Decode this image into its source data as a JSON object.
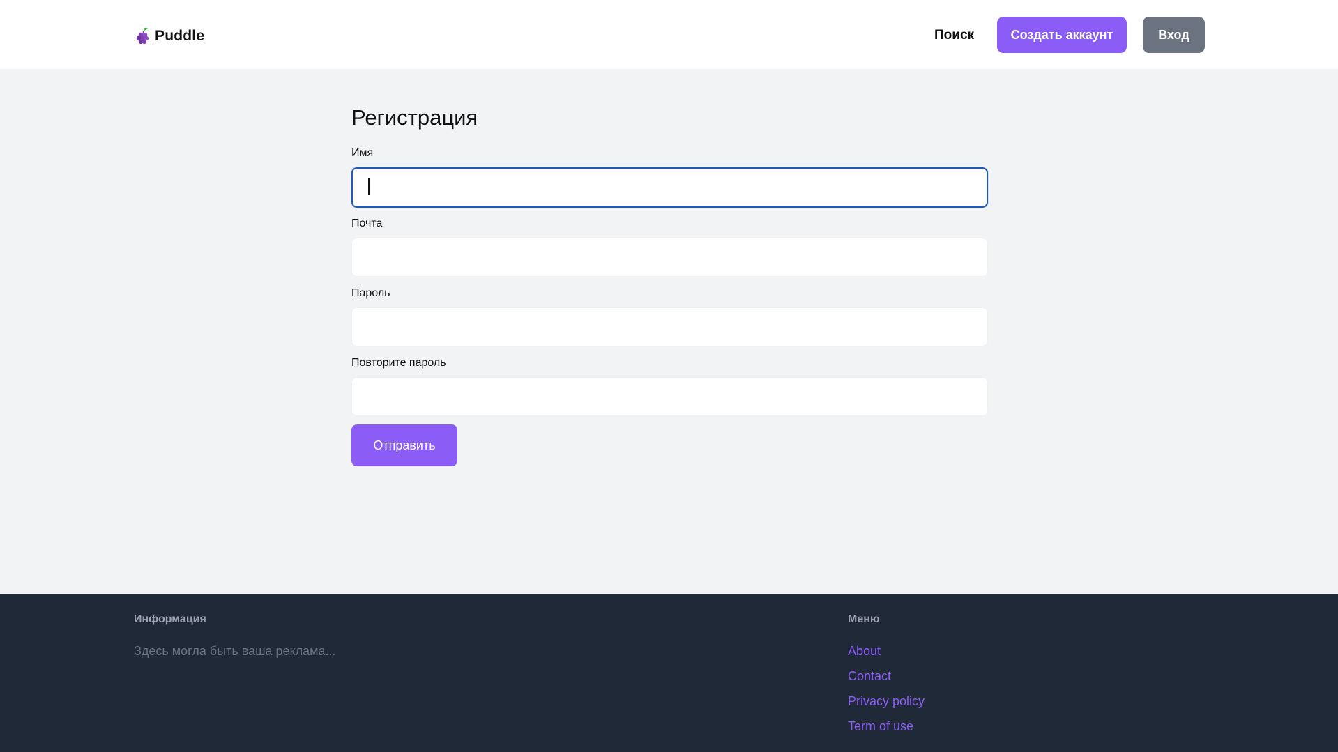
{
  "header": {
    "brand": "Puddle",
    "logo_icon": "grapes-icon",
    "nav_search": "Поиск",
    "create_account": "Создать аккаунт",
    "login": "Вход"
  },
  "form": {
    "title": "Регистрация",
    "fields": [
      {
        "label": "Имя",
        "value": "",
        "focused": true
      },
      {
        "label": "Почта",
        "value": ""
      },
      {
        "label": "Пароль",
        "value": ""
      },
      {
        "label": "Повторите пароль",
        "value": ""
      }
    ],
    "submit": "Отправить"
  },
  "footer": {
    "info_heading": "Информация",
    "info_text": "Здесь могла быть ваша реклама...",
    "menu_heading": "Меню",
    "links": [
      "About",
      "Contact",
      "Privacy policy",
      "Term of use"
    ]
  },
  "colors": {
    "accent": "#8b5cf6",
    "secondary_button": "#6b7280",
    "focus_ring": "#1e5bb8",
    "footer_bg": "#1f2937",
    "page_bg": "#f2f3f5"
  }
}
